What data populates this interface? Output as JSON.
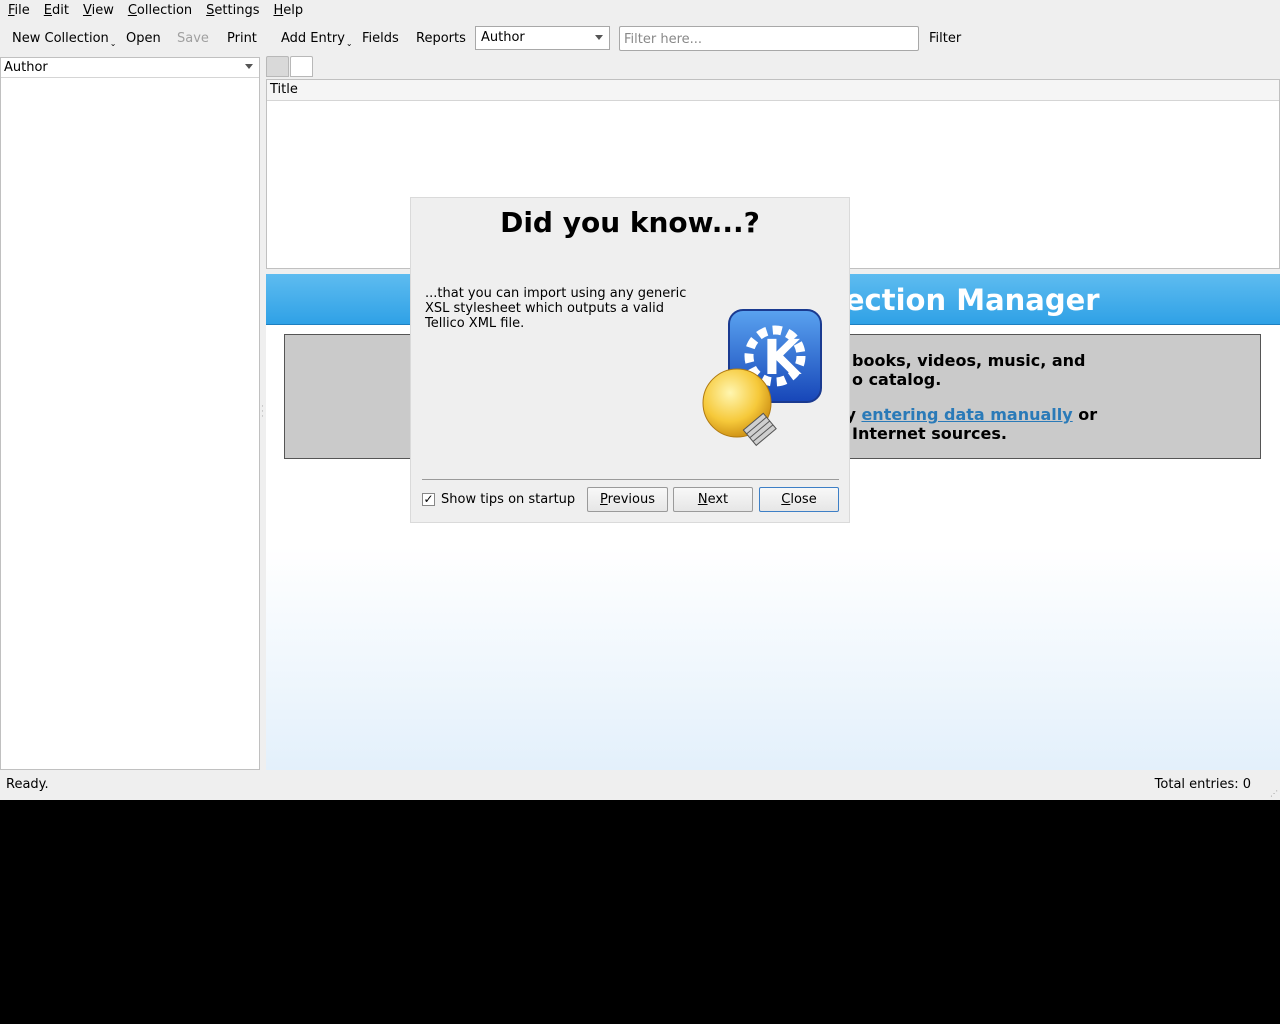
{
  "menubar": {
    "items": [
      {
        "accel": "F",
        "rest": "ile"
      },
      {
        "accel": "E",
        "rest": "dit"
      },
      {
        "accel": "V",
        "rest": "iew"
      },
      {
        "accel": "C",
        "rest": "ollection"
      },
      {
        "accel": "S",
        "rest": "ettings"
      },
      {
        "accel": "H",
        "rest": "elp"
      }
    ]
  },
  "toolbar": {
    "new_collection": "New Collection",
    "open": "Open",
    "save": "Save",
    "print": "Print",
    "add_entry": "Add Entry",
    "fields": "Fields",
    "reports": "Reports",
    "group_combo_value": "Author",
    "filter_placeholder": "Filter here...",
    "filter_label": "Filter"
  },
  "sidebar": {
    "header": "Author"
  },
  "table": {
    "column_title": "Title"
  },
  "welcome": {
    "banner_title": "llection Manager",
    "line1": "books, videos, music, and",
    "line2": "o catalog.",
    "line3_prefix": "by ",
    "line3_link": "entering data manually",
    "line3_suffix": " or",
    "line4": "Internet sources."
  },
  "dialog": {
    "title": "Did you know...?",
    "tip_text": "...that you can import using any generic XSL stylesheet which outputs a valid Tellico XML file.",
    "show_tips_label": "Show tips on startup",
    "show_tips_checked": true,
    "previous_accel": "P",
    "previous_rest": "revious",
    "next_accel": "N",
    "next_rest": "ext",
    "close_accel": "C",
    "close_rest": "lose"
  },
  "statusbar": {
    "status": "Ready.",
    "total_entries": "Total entries: 0"
  },
  "colors": {
    "banner": "#2fa1e6",
    "link": "#2a7ab8",
    "default_button_border": "#3d7fc6"
  }
}
